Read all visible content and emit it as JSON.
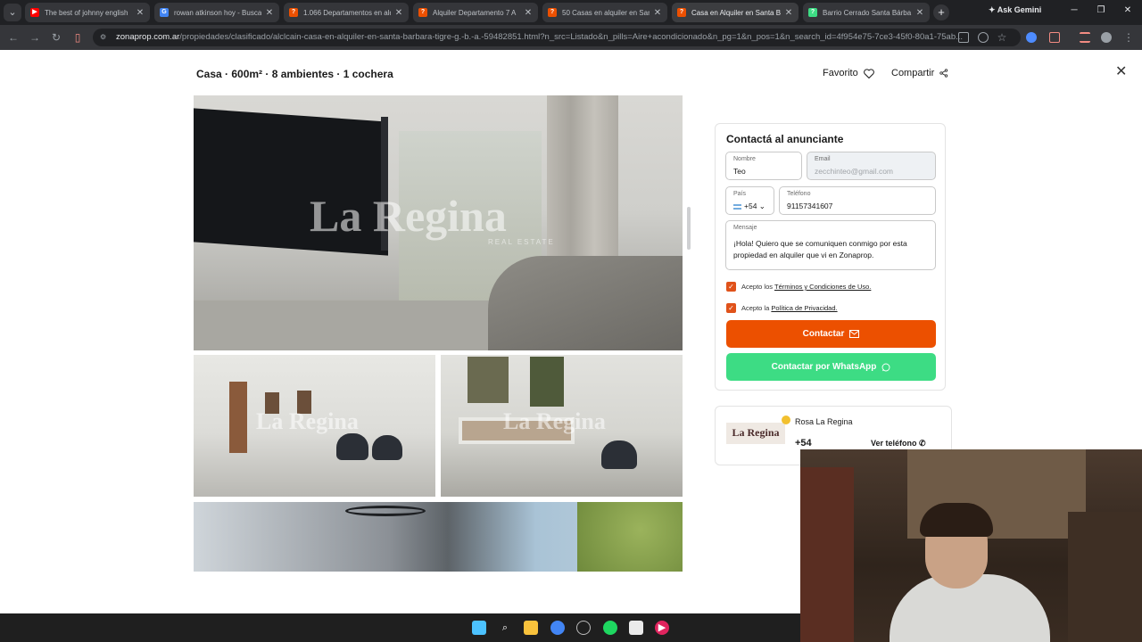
{
  "browser": {
    "tabs": [
      {
        "title": "The best of johnny english",
        "favicon": "youtube-icon",
        "color": "#ff0000"
      },
      {
        "title": "rowan atkinson hoy - Buscar",
        "favicon": "google-icon",
        "color": "#4285f4"
      },
      {
        "title": "1.066 Departamentos en alq",
        "favicon": "zonaprop-icon",
        "color": "#ec5000"
      },
      {
        "title": "Alquiler Departamento 7 A",
        "favicon": "zonaprop-icon",
        "color": "#ec5000"
      },
      {
        "title": "50 Casas en alquiler en San",
        "favicon": "zonaprop-icon",
        "color": "#ec5000"
      },
      {
        "title": "Casa en Alquiler en Santa B",
        "favicon": "zonaprop-icon",
        "color": "#ec5000",
        "active": true
      },
      {
        "title": "Barrio Cerrado Santa Bárba",
        "favicon": "web-icon",
        "color": "#3ddc84"
      }
    ],
    "new_tab": "+",
    "ask_gemini": "Ask Gemini",
    "url_domain": "zonaprop.com.ar",
    "url_path": "/propiedades/clasificado/alclcain-casa-en-alquiler-en-santa-barbara-tigre-g.-b.-a.-59482851.html?n_src=Listado&n_pills=Aire+acondicionado&n_pg=1&n_pos=1&n_search_id=4f954e75-7ce3-45f0-80a1-75ab..."
  },
  "listing": {
    "title": "Casa · 600m² · 8 ambientes · 1 cochera",
    "favorite_label": "Favorito",
    "share_label": "Compartir",
    "watermark": "La Regina",
    "watermark_sub": "REAL ESTATE"
  },
  "contact": {
    "title": "Contactá al anunciante",
    "name_label": "Nombre",
    "name_value": "Teo",
    "email_label": "Email",
    "email_placeholder": "zecchinteo@gmail.com",
    "country_label": "País",
    "country_code": "+54",
    "phone_label": "Teléfono",
    "phone_value": "91157341607",
    "message_label": "Mensaje",
    "message_value": "¡Hola! Quiero que se comuniquen conmigo por esta propiedad en alquiler que vi en Zonaprop.",
    "terms_prefix": "Acepto los",
    "terms_link": "Términos y Condiciones de Uso.",
    "privacy_prefix": "Acepto la",
    "privacy_link": "Política de Privacidad.",
    "contact_button": "Contactar",
    "whatsapp_button": "Contactar por WhatsApp"
  },
  "agent": {
    "logo_text": "La Regina",
    "name": "Rosa La Regina",
    "phone_prefix": "+54",
    "phone_button": "Ver teléfono"
  },
  "colors": {
    "accent": "#ec5000",
    "whatsapp": "#3ddc84"
  }
}
